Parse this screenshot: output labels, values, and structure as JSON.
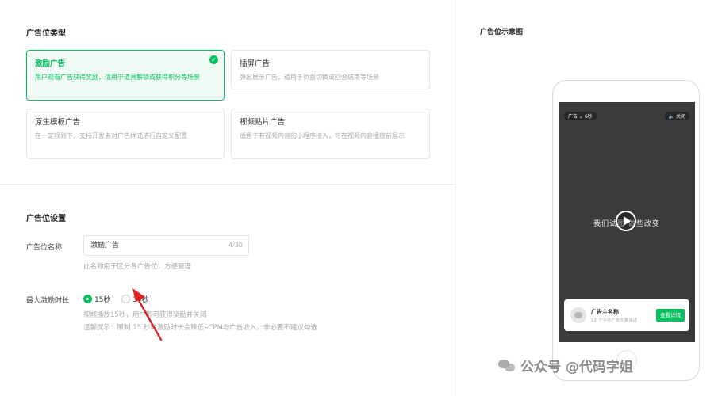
{
  "ad_type": {
    "title": "广告位类型",
    "cards": [
      {
        "name": "激励广告",
        "desc": "用户观看广告获得奖励，适用于道具解锁或获得积分等场景",
        "selected": true
      },
      {
        "name": "插屏广告",
        "desc": "弹出展示广告，适用于页面切换或回合结束等场景",
        "selected": false
      },
      {
        "name": "原生模板广告",
        "desc": "在一定规则下，支持开发者对广告样式进行自定义配置",
        "selected": false
      },
      {
        "name": "视频贴片广告",
        "desc": "适用于有视频内容的小程序接入，可在视频内容播放前展示",
        "selected": false
      }
    ]
  },
  "settings": {
    "title": "广告位设置",
    "name_label": "广告位名称",
    "name_value": "激励广告",
    "name_count": "4/30",
    "name_hint": "此名称用于区分各广告位，方便管理",
    "duration_label": "最大激励时长",
    "options": [
      {
        "label": "15秒",
        "checked": true
      },
      {
        "label": "30秒",
        "checked": false
      }
    ],
    "hint1": "视频播放15秒，用户即可获得奖励并关闭",
    "hint2": "温馨提示：限制 15 秒的激励时长会降低eCPM与广告收入，非必要不建议勾选"
  },
  "preview": {
    "title": "广告位示意图",
    "ad_tag": "广告 ⌄ 6秒",
    "mute": "🔈 关闭",
    "video_text": "我们试图 做些改变",
    "advertiser": "广告主名称",
    "ad_desc": "12 个字符广告文案描述",
    "cta": "查看详情"
  },
  "watermark": {
    "text": "公众号 @代码字姐"
  },
  "colors": {
    "accent": "#07c160",
    "arrow": "#e02020"
  }
}
